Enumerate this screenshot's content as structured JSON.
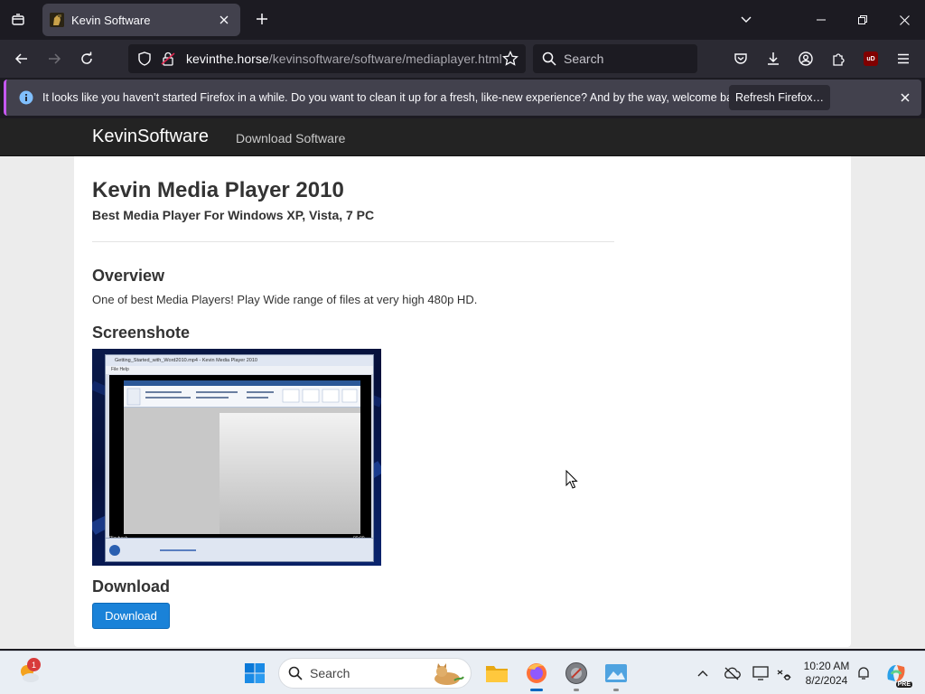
{
  "browser": {
    "tab": {
      "title": "Kevin Software"
    },
    "url": {
      "host": "kevinthe.horse",
      "path": "/kevinsoftware/software/mediaplayer.html"
    },
    "search": {
      "placeholder": "Search"
    },
    "extension_badge": "uD",
    "notification": {
      "message": "It looks like you haven’t started Firefox in a while. Do you want to clean it up for a fresh, like-new experience? And by the way, welcome back!",
      "button": "Refresh Firefox…"
    }
  },
  "site": {
    "brand": "KevinSoftware",
    "nav_link": "Download Software"
  },
  "content": {
    "title": "Kevin Media Player 2010",
    "subtitle": "Best Media Player For Windows XP, Vista, 7 PC",
    "overview_heading": "Overview",
    "overview_text": "One of best Media Players! Play Wide range of files at very high 480p HD.",
    "screenshot_heading": "Screenshote",
    "screenshot": {
      "window_title": "Getting_Started_with_Word2010.mp4 - Kevin Media Player 2010",
      "menu": "File    Help",
      "status": "Playback",
      "time": "00:00"
    },
    "download_heading": "Download",
    "download_button": "Download"
  },
  "taskbar": {
    "search_placeholder": "Search",
    "weather_badge": "1",
    "clock_time": "10:20 AM",
    "clock_date": "8/2/2024",
    "copilot_label": "PRE"
  },
  "colors": {
    "accent_button": "#1a82d8",
    "notification_stripe": "#c658f2",
    "browser_bg": "#1c1b22"
  }
}
